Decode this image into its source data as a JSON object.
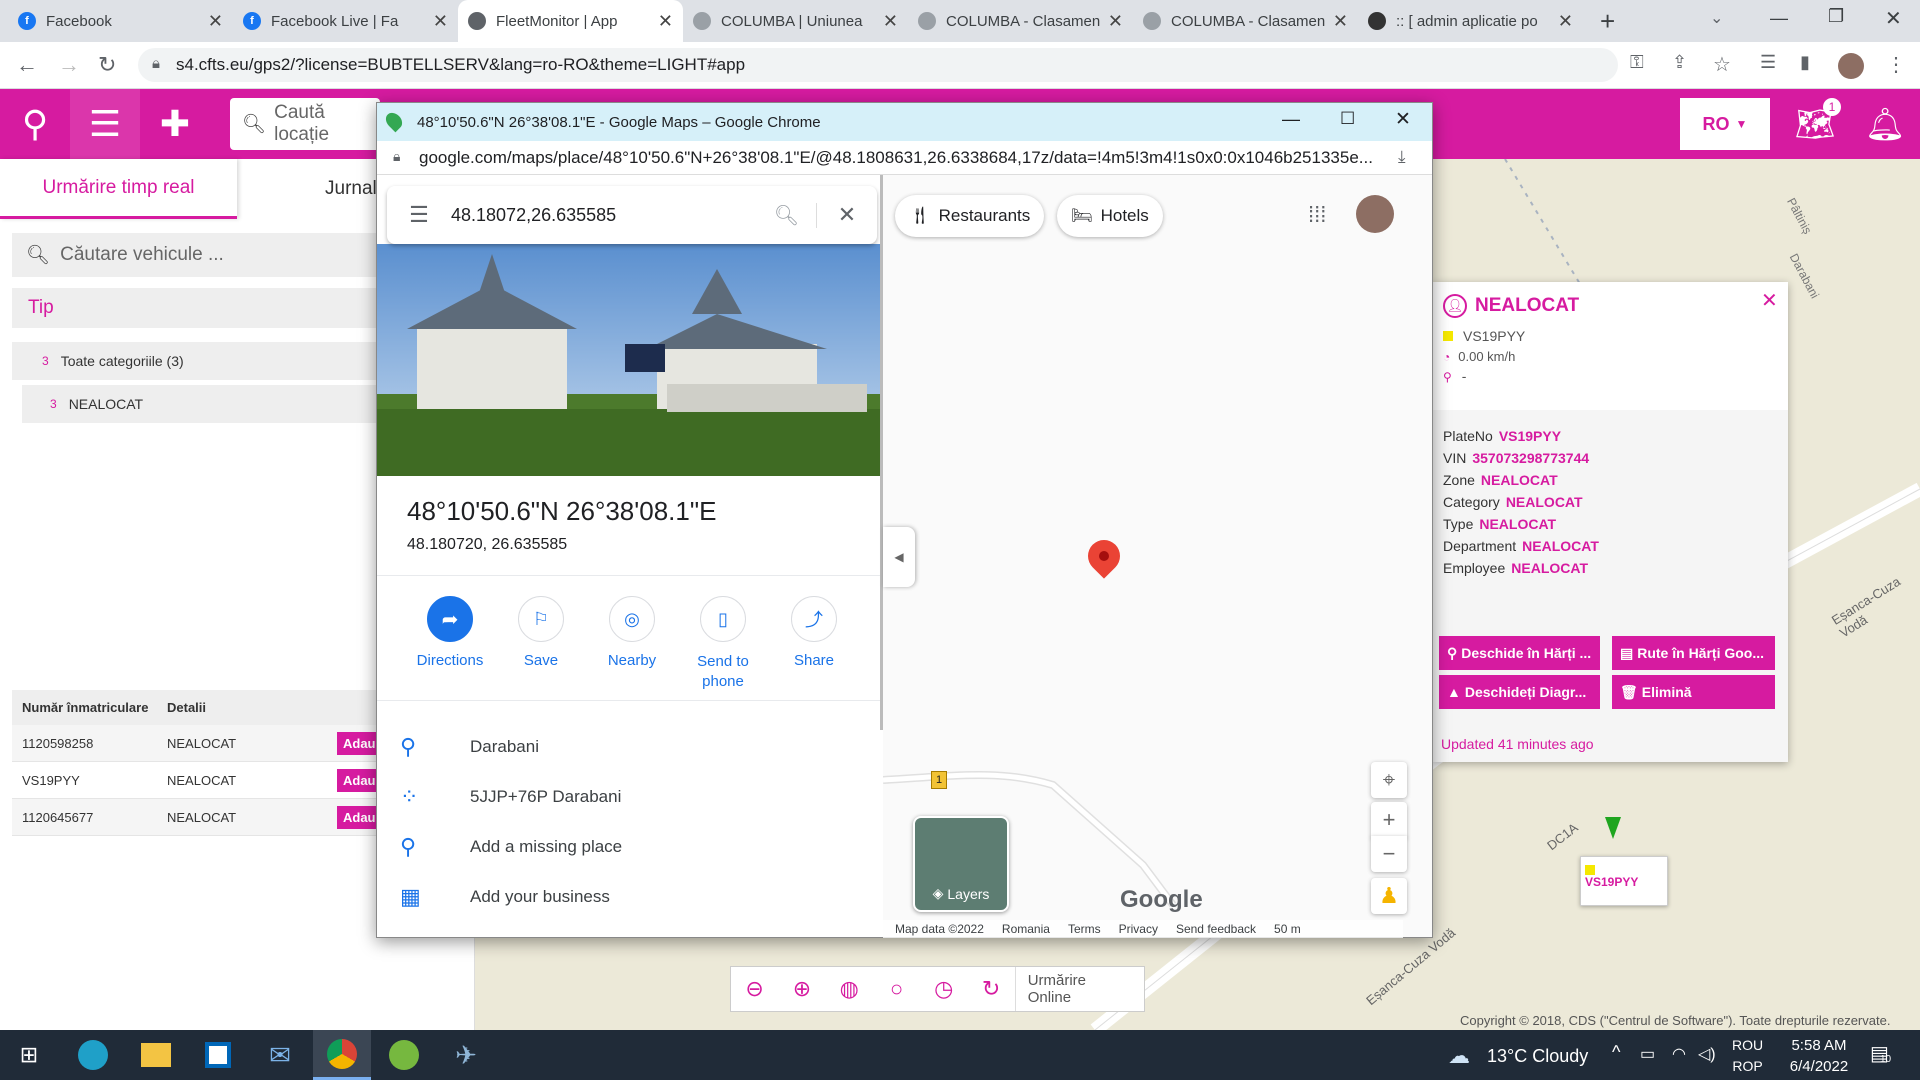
{
  "browser": {
    "tabs": [
      {
        "title": "Facebook",
        "favicon": "facebook-icon",
        "color": "#1877f2"
      },
      {
        "title": "Facebook Live | Fa",
        "favicon": "facebook-icon",
        "color": "#1877f2"
      },
      {
        "title": "FleetMonitor | App",
        "favicon": "globe-icon",
        "color": "#5f6368"
      },
      {
        "title": "COLUMBA | Uniunea ",
        "favicon": "loading-icon",
        "color": "#9aa0a6"
      },
      {
        "title": "COLUMBA - Clasamen",
        "favicon": "loading-icon",
        "color": "#9aa0a6"
      },
      {
        "title": "COLUMBA - Clasamen",
        "favicon": "loading-icon",
        "color": "#9aa0a6"
      },
      {
        "title": ":: [ admin aplicatie po",
        "favicon": "site-icon",
        "color": "#333333"
      }
    ],
    "url": "s4.cfts.eu/gps2/?license=BUBTELLSERV&lang=ro-RO&theme=LIGHT#app"
  },
  "app": {
    "accent": "#d61ba0",
    "location_search_placeholder": "Caută locație",
    "language": "RO",
    "map_badge": "1",
    "tabs": [
      "Urmărire timp real",
      "Jurnal"
    ],
    "vehicle_search_placeholder": "Căutare vehicule ...",
    "type_label": "Tip",
    "categories": [
      {
        "count": "3",
        "label": "Toate categoriile (3)"
      },
      {
        "count": "3",
        "label": "NEALOCAT"
      }
    ],
    "table": {
      "headers": [
        "Număr înmatriculare",
        "Detalii"
      ],
      "rows": [
        {
          "plate": "1120598258",
          "details": "NEALOCAT",
          "action": "Adau"
        },
        {
          "plate": "VS19PYY",
          "details": "NEALOCAT",
          "action": "Adau"
        },
        {
          "plate": "1120645677",
          "details": "NEALOCAT",
          "action": "Adau"
        }
      ]
    },
    "popup": {
      "title": "NEALOCAT",
      "plate": "VS19PYY",
      "speed": "0.00 km/h",
      "location": "-",
      "fields": [
        {
          "key": "PlateNo",
          "value": "VS19PYY"
        },
        {
          "key": "VIN",
          "value": "357073298773744"
        },
        {
          "key": "Zone",
          "value": "NEALOCAT"
        },
        {
          "key": "Category",
          "value": "NEALOCAT"
        },
        {
          "key": "Type",
          "value": "NEALOCAT"
        },
        {
          "key": "Department",
          "value": "NEALOCAT"
        },
        {
          "key": "Employee",
          "value": "NEALOCAT"
        }
      ],
      "buttons": [
        "Deschide în Hărți ...",
        "Rute în Hărți Goo...",
        "Deschideți Diagr...",
        "Elimină"
      ],
      "updated": "Updated 41 minutes ago"
    },
    "map": {
      "road_labels": [
        "Pâltiniș",
        "Darabani",
        "Eșanca-Cuza Vodă",
        "DC1A",
        "Eșanca-Cuza Vodă"
      ],
      "marker_label": "VS19PYY",
      "online_label": "Urmărire Online",
      "copyright": "Copyright © 2018, CDS (\"Centrul de Software\"). Toate drepturile rezervate."
    }
  },
  "gmaps": {
    "window_title": "48°10'50.6\"N 26°38'08.1\"E - Google Maps – Google Chrome",
    "url": "google.com/maps/place/48°10'50.6\"N+26°38'08.1\"E/@48.1808631,26.6338684,17z/data=!4m5!3m4!1s0x0:0x1046b251335e...",
    "search_value": "48.18072,26.635585",
    "place_title": "48°10'50.6\"N 26°38'08.1\"E",
    "place_coords": "48.180720, 26.635585",
    "actions": [
      "Directions",
      "Save",
      "Nearby",
      "Send to phone",
      "Share"
    ],
    "list": [
      "Darabani",
      "5JJP+76P Darabani",
      "Add a missing place",
      "Add your business"
    ],
    "chips": [
      "Restaurants",
      "Hotels"
    ],
    "layers_label": "Layers",
    "road_number": "1",
    "logo": "Google",
    "footer": [
      "Map data ©2022",
      "Romania",
      "Terms",
      "Privacy",
      "Send feedback",
      "50 m"
    ]
  },
  "taskbar": {
    "weather": "13°C  Cloudy",
    "lang_top": "ROU",
    "lang_bottom": "ROP",
    "time": "5:58 AM",
    "date": "6/4/2022",
    "notifications": "10"
  }
}
